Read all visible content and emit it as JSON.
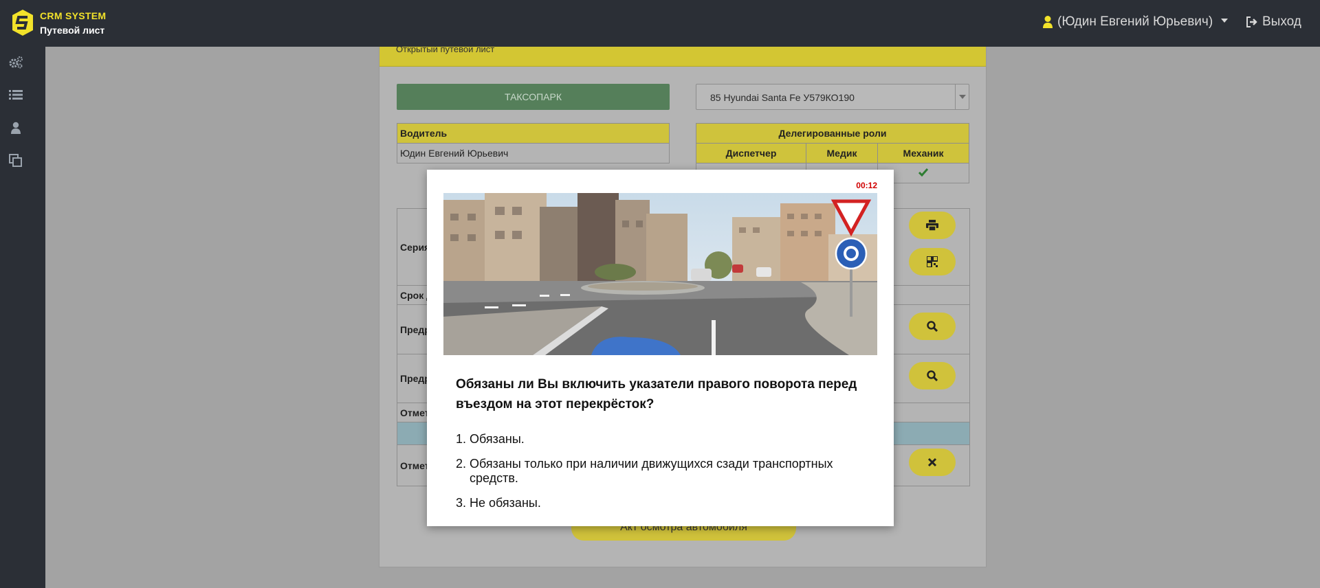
{
  "header": {
    "brand_title": "CRM SYSTEM",
    "brand_subtitle": "Путевой лист",
    "user_label": "(Юдин Евгений Юрьевич)",
    "logout_label": "Выход"
  },
  "sidebar": {
    "items": [
      {
        "icon": "gears-icon"
      },
      {
        "icon": "list-icon"
      },
      {
        "icon": "user-icon"
      },
      {
        "icon": "copy-icon"
      }
    ]
  },
  "panel": {
    "header_title": "Открытый путевой лист",
    "taxi_park_button": "ТАКСОПАРК",
    "car_select_value": "85 Hyundai Santa Fe У579КО190",
    "driver_table": {
      "header": "Водитель",
      "value": "Юдин Евгений Юрьевич"
    },
    "roles_table": {
      "header": "Делегированные роли",
      "columns": [
        "Диспетчер",
        "Медик",
        "Механик"
      ]
    },
    "rows": [
      {
        "label": "Серия"
      },
      {
        "label": "Срок д"
      },
      {
        "label": "Предр"
      },
      {
        "label": "Предр"
      },
      {
        "label": "Отмет"
      },
      {
        "label": ""
      },
      {
        "label": "Отмет"
      }
    ],
    "act_button": "Акт осмотра автомобиля"
  },
  "modal": {
    "timer": "00:12",
    "question": "Обязаны ли Вы включить указатели правого поворота перед въездом на этот перекрёсток?",
    "answers": [
      {
        "num": "1.",
        "text": "Обязаны."
      },
      {
        "num": "2.",
        "text": "Обязаны только при наличии движущихся сзади транспортных средств."
      },
      {
        "num": "3.",
        "text": "Не обязаны."
      }
    ]
  },
  "colors": {
    "accent_yellow": "#f2e22a",
    "topbar": "#2b2f36",
    "timer_red": "#d00000"
  }
}
